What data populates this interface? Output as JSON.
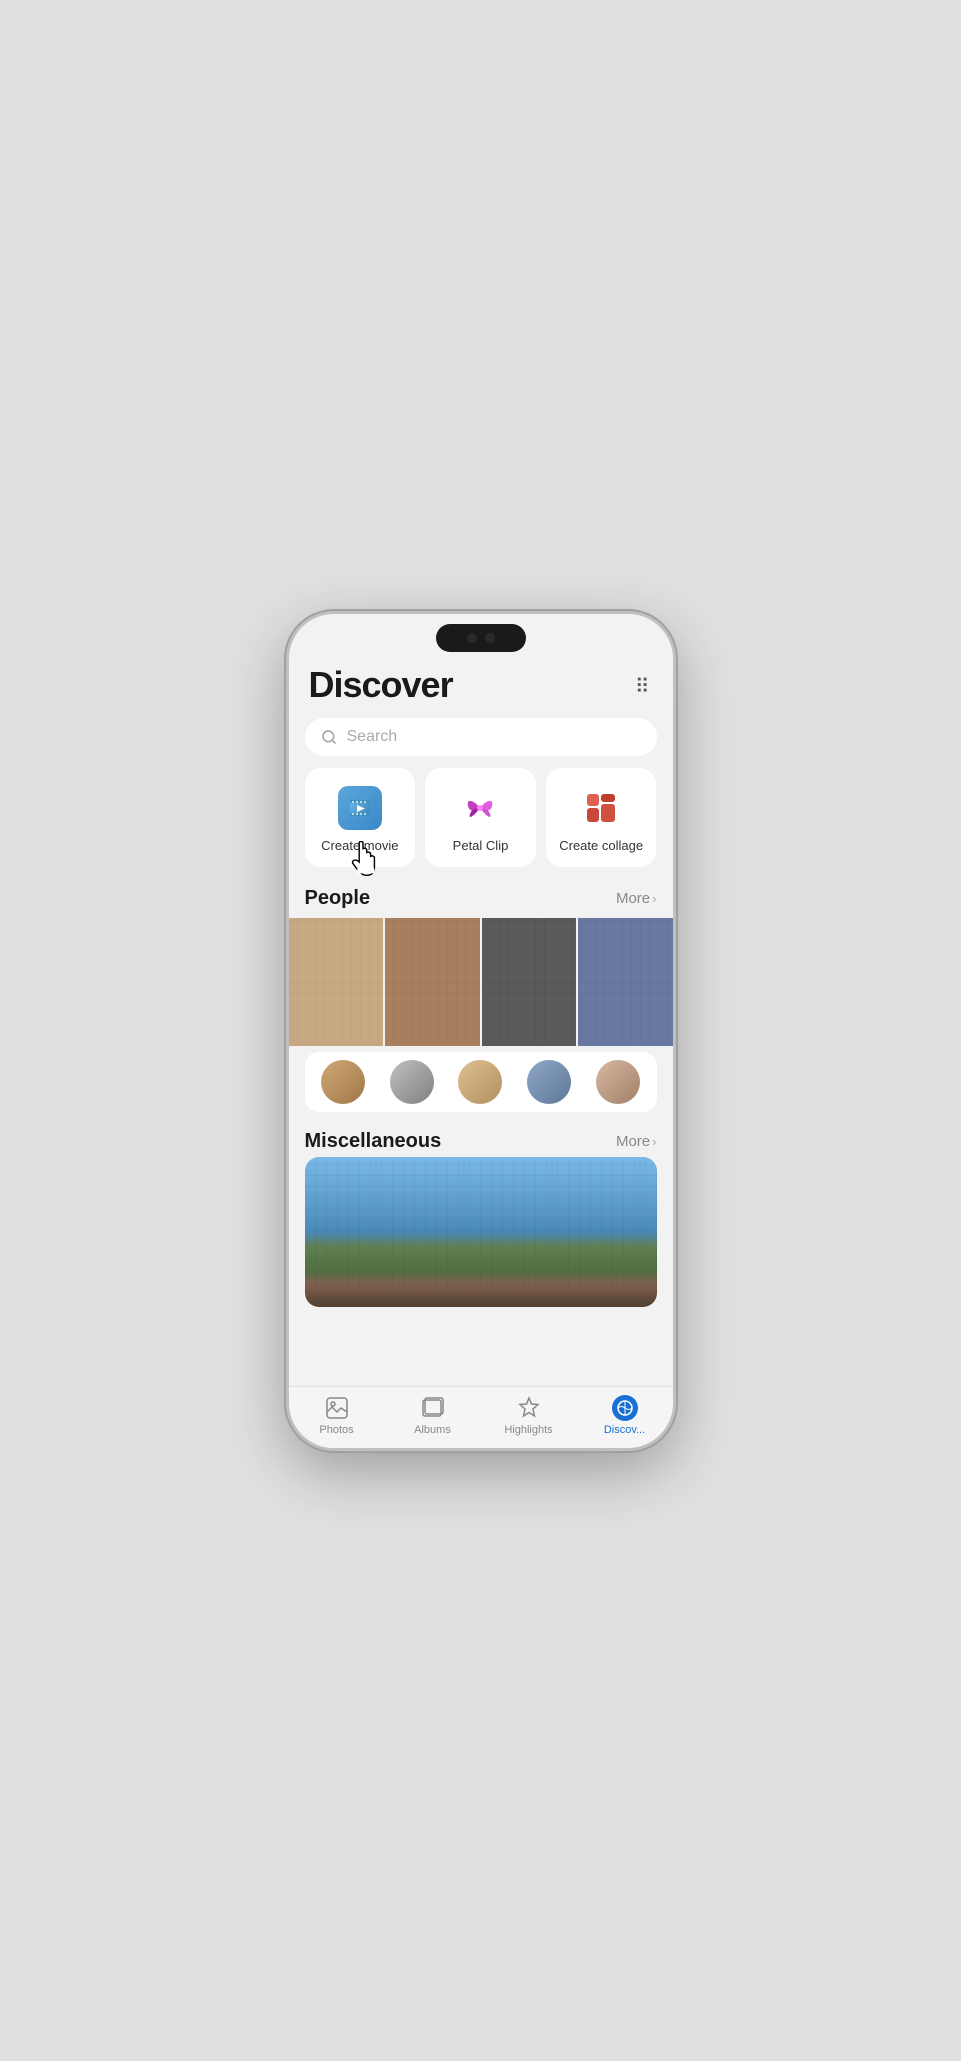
{
  "phone": {
    "title": "Discover"
  },
  "header": {
    "title": "Discover",
    "menu_dots": "⋮⋮"
  },
  "search": {
    "placeholder": "Search"
  },
  "actions": [
    {
      "id": "create-movie",
      "label": "Create movie"
    },
    {
      "id": "petal-clip",
      "label": "Petal Clip"
    },
    {
      "id": "create-collage",
      "label": "Create collage"
    }
  ],
  "sections": {
    "people": {
      "title": "People",
      "more_label": "More",
      "more_chevron": "›"
    },
    "miscellaneous": {
      "title": "Miscellaneous",
      "more_label": "More",
      "more_chevron": "›"
    }
  },
  "bottom_nav": [
    {
      "id": "photos",
      "label": "Photos",
      "active": false
    },
    {
      "id": "albums",
      "label": "Albums",
      "active": false
    },
    {
      "id": "highlights",
      "label": "Highlights",
      "active": false
    },
    {
      "id": "discover",
      "label": "Discov...",
      "active": true
    }
  ]
}
